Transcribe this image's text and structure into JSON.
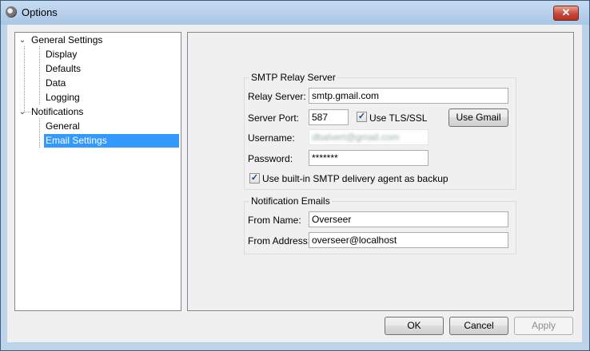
{
  "window": {
    "title": "Options",
    "close_label": "✕"
  },
  "tree": {
    "nodes": [
      {
        "label": "General Settings",
        "expander": "⌄"
      },
      {
        "label": "Display"
      },
      {
        "label": "Defaults"
      },
      {
        "label": "Data"
      },
      {
        "label": "Logging"
      },
      {
        "label": "Notifications",
        "expander": "⌄"
      },
      {
        "label": "General"
      },
      {
        "label": "Email Settings",
        "selected": true
      }
    ]
  },
  "smtp": {
    "group_title": "SMTP Relay Server",
    "relay_label": "Relay Server:",
    "relay_value": "smtp.gmail.com",
    "port_label": "Server Port:",
    "port_value": "587",
    "tls_label": "Use TLS/SSL",
    "tls_checked": "✓",
    "gmail_button": "Use Gmail",
    "username_label": "Username:",
    "username_value": "dbalvert@gmail.com",
    "password_label": "Password:",
    "password_value": "*******",
    "backup_label": "Use built-in SMTP delivery agent as backup",
    "backup_checked": "✓"
  },
  "notification_emails": {
    "group_title": "Notification Emails",
    "from_name_label": "From Name:",
    "from_name_value": "Overseer",
    "from_address_label": "From Address:",
    "from_address_value": "overseer@localhost"
  },
  "buttons": {
    "ok": "OK",
    "cancel": "Cancel",
    "apply": "Apply"
  },
  "colors": {
    "selection": "#3399ff",
    "titlebar": "#bcd3ea",
    "close": "#c8473b"
  }
}
